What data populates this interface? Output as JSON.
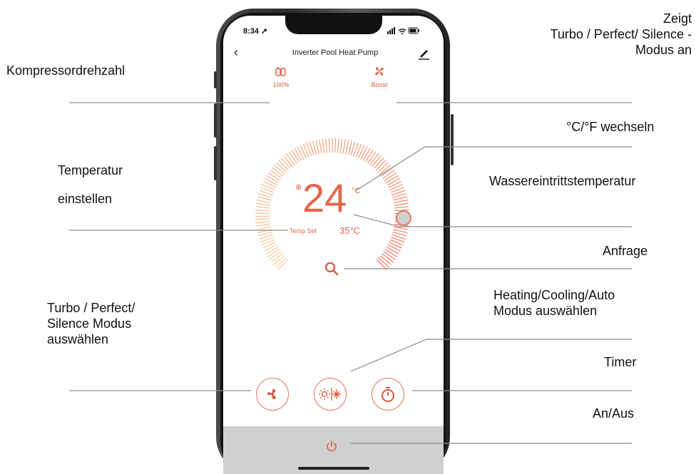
{
  "callouts": {
    "kompressor": "Kompressordrehzahl",
    "zeigt": [
      "Zeigt",
      "Turbo / Perfect/ Silence -",
      "Modus an"
    ],
    "temp_einstellen": [
      "Temperatur",
      "einstellen"
    ],
    "celsius": "°C/°F wechseln",
    "wasser": "Wassereintrittstemperatur",
    "anfrage": "Anfrage",
    "heating": [
      "Heating/Cooling/Auto",
      "Modus  auswählen"
    ],
    "turbo": [
      "Turbo / Perfect/",
      "Silence Modus",
      "auswählen"
    ],
    "timer": "Timer",
    "anaus": "An/Aus"
  },
  "status_bar": {
    "time": "8:34",
    "icons": "signal wifi battery"
  },
  "app": {
    "title": "Inverter Pool Heat Pump",
    "compressor": {
      "icon": "compressor-icon",
      "value": "100%"
    },
    "mode": {
      "icon": "fan-blade-icon",
      "value": "Boost"
    },
    "temperature": {
      "current": "24",
      "unit": "°C",
      "set_label": "Temp Set",
      "set_value": "35°C"
    },
    "accent": "#e4654a"
  },
  "buttons": [
    "fan-icon",
    "sun-snowflake-icon",
    "timer-icon",
    "power-icon"
  ]
}
